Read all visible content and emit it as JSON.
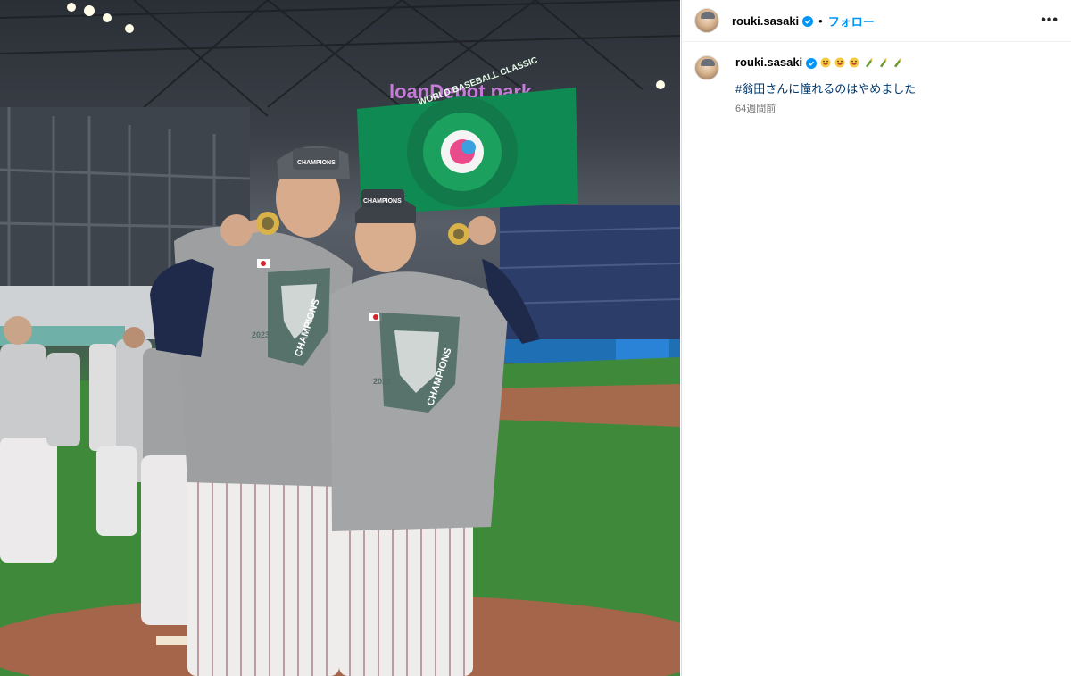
{
  "post": {
    "username": "rouki.sasaki",
    "follow_label": "フォロー",
    "separator": "•",
    "more_label": "•••",
    "caption_hashtag": "#翁田さんに憧れるのはやめました",
    "timestamp": "64週間前",
    "caption_emojis": [
      "grinning-face-icon",
      "grinning-face-icon",
      "grinning-face-icon",
      "champagne-icon",
      "champagne-icon",
      "champagne-icon"
    ]
  },
  "photo": {
    "stadium_sign": "loanDepot park",
    "scoreboard_text": "WORLD BASEBALL CLASSIC",
    "shirt_text": "CHAMPIONS",
    "shirt_year": "2023",
    "cap_text": "CHAMPIONS"
  },
  "colors": {
    "accent": "#0095f6",
    "hashtag": "#00376b",
    "muted": "#737373"
  }
}
